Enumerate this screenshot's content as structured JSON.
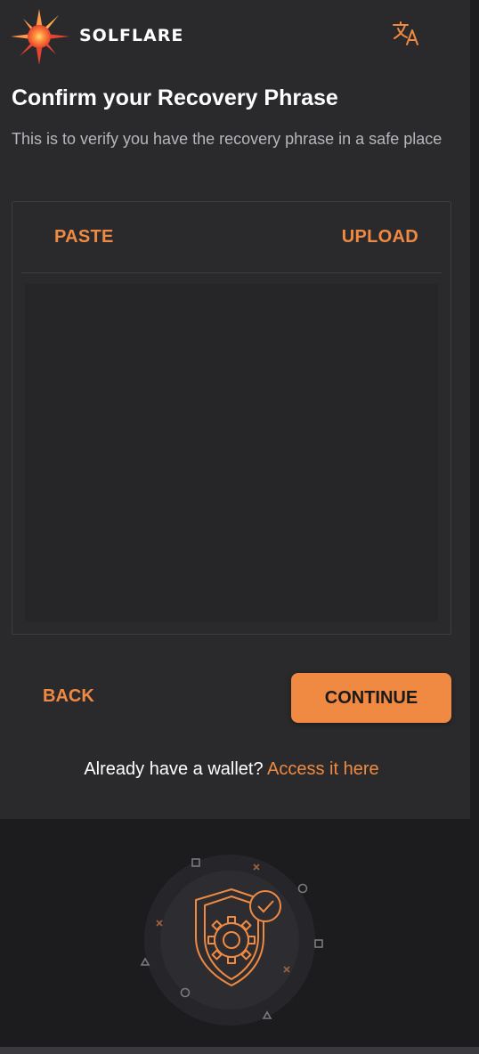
{
  "header": {
    "brand": "SOLFLARE",
    "logo_icon": "sun-burst-icon",
    "language_icon": "translate-icon"
  },
  "page": {
    "title": "Confirm your Recovery Phrase",
    "subtitle": "This is to verify you have the recovery phrase in a safe place"
  },
  "phrase_box": {
    "tabs": {
      "paste": "PASTE",
      "upload": "UPLOAD"
    },
    "value": ""
  },
  "actions": {
    "back": "BACK",
    "continue": "CONTINUE"
  },
  "footer_text": {
    "prompt": "Already have a wallet?",
    "link": "Access it here"
  },
  "illustration": {
    "icon": "shield-gear-check-icon"
  },
  "colors": {
    "accent": "#f08a42",
    "background": "#2a2a2d",
    "footer_background": "#1c1c1f",
    "muted_text": "#b7b7bb",
    "border": "#3d3d41"
  }
}
